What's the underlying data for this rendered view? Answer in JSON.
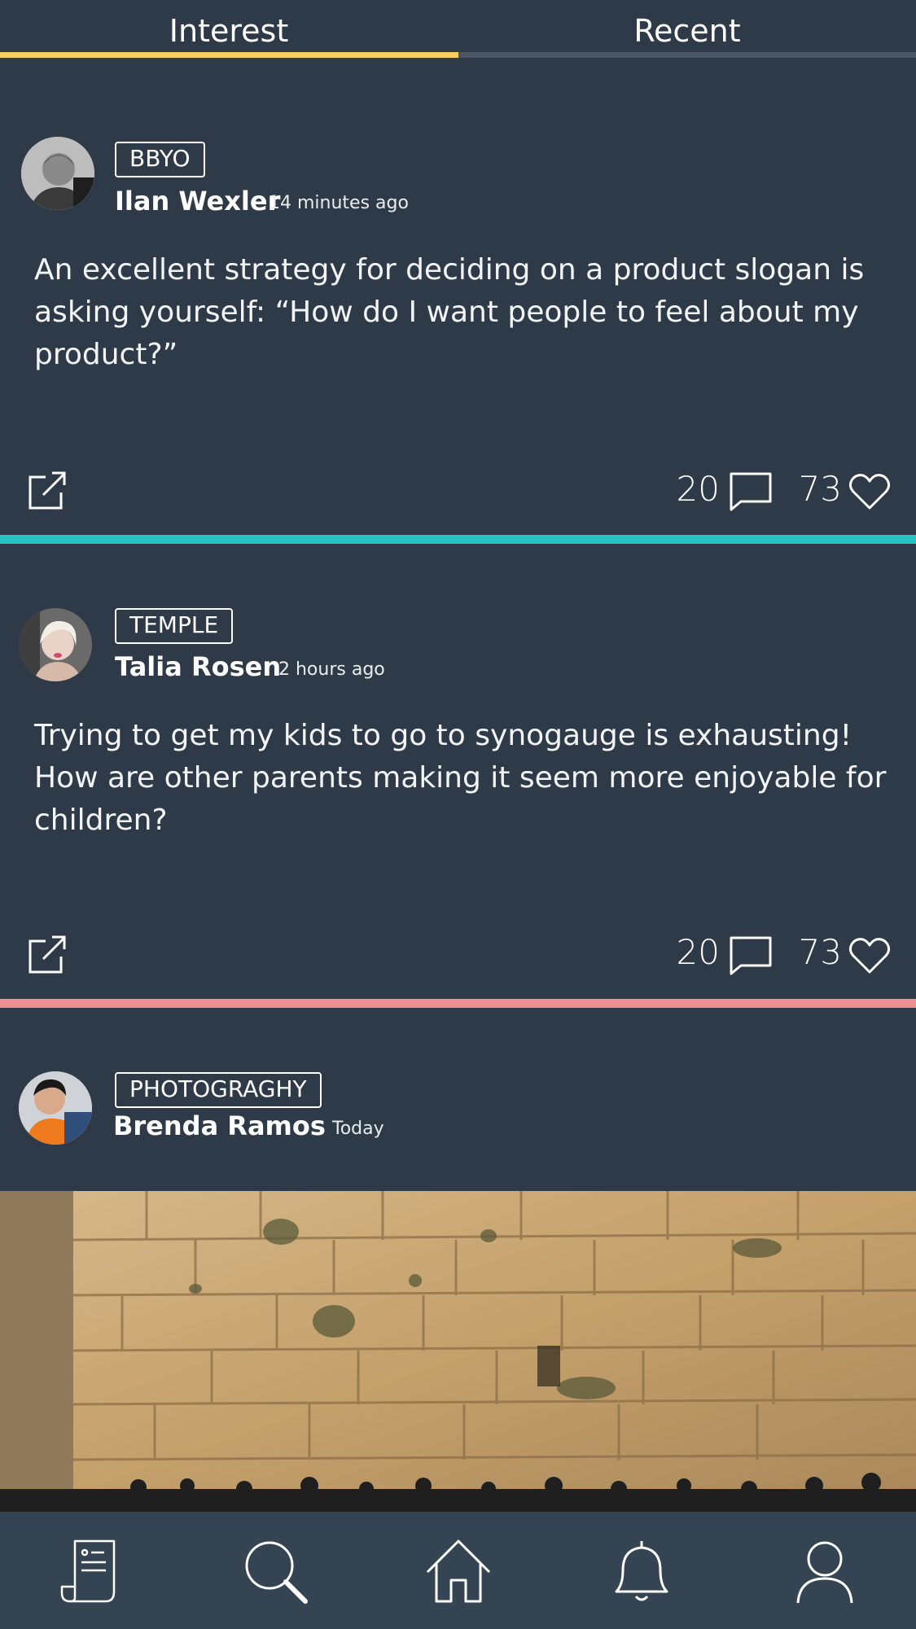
{
  "tabs": [
    {
      "label": "Interest",
      "active": true
    },
    {
      "label": "Recent",
      "active": false
    }
  ],
  "colors": {
    "background": "#2e3a47",
    "tab_active": "#f7cf5e",
    "divider_teal": "#27c4c4",
    "divider_pink": "#f09090",
    "nav_background": "#354452"
  },
  "posts": [
    {
      "tag": "BBYO",
      "author": "Ilan Wexler",
      "time": "14 minutes ago",
      "text": "An excellent strategy for deciding on a product slogan is asking yourself: “How do I want people to feel about my product?”",
      "comments": "20",
      "likes": "73"
    },
    {
      "tag": "TEMPLE",
      "author": "Talia Rosen",
      "time": "2 hours ago",
      "text": "Trying to get my kids to go to synogauge is exhausting! How are other parents making it seem more enjoyable for children?",
      "comments": "20",
      "likes": "73"
    },
    {
      "tag": "PHOTOGRAGHY",
      "author": "Brenda Ramos",
      "time": "Today"
    }
  ],
  "nav": {
    "items": [
      "scroll-icon",
      "search-icon",
      "home-icon",
      "bell-icon",
      "user-icon"
    ]
  }
}
